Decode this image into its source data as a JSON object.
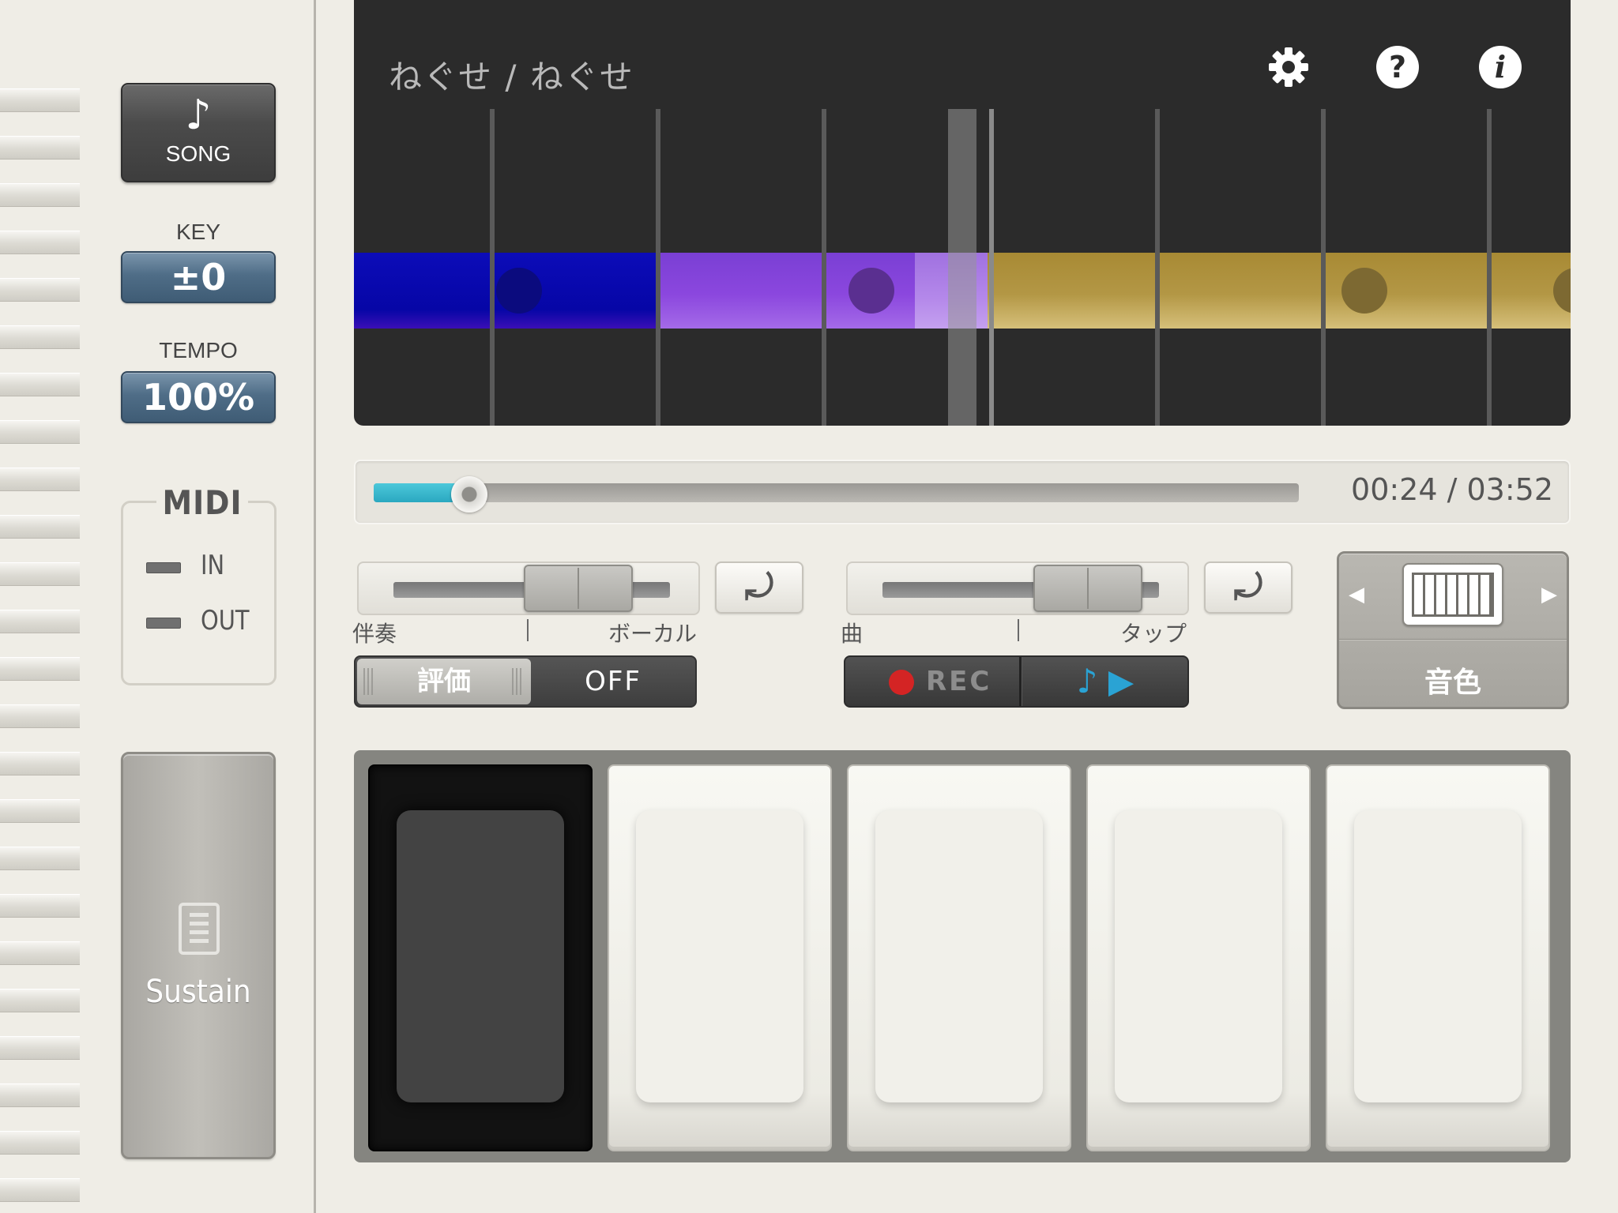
{
  "song_button": {
    "icon": "music-note-icon",
    "label": "SONG"
  },
  "key": {
    "label": "KEY",
    "value": "±0"
  },
  "tempo": {
    "label": "TEMPO",
    "value": "100%"
  },
  "midi": {
    "title": "MIDI",
    "in_label": "IN",
    "out_label": "OUT"
  },
  "sustain": {
    "icon": "sustain-pedal-icon",
    "label": "Sustain"
  },
  "screen": {
    "song_title": "ねぐせ / ねぐせ",
    "icons": [
      "settings-gear-icon",
      "help-icon",
      "info-icon"
    ],
    "help_glyph": "?",
    "info_glyph": "i",
    "lane_colors": [
      "#0a0ab0",
      "#8b47de",
      "#b39745"
    ]
  },
  "progress": {
    "time_text": "00:24 / 03:52",
    "fraction": 0.103,
    "accent": "#2aa8c0"
  },
  "balance_left": {
    "left_label": "伴奏",
    "right_label": "ボーカル",
    "value": 0.72,
    "reset_glyph": "⤾"
  },
  "balance_right": {
    "left_label": "曲",
    "right_label": "タップ",
    "value": 0.81,
    "reset_glyph": "⤾"
  },
  "score": {
    "label": "評価",
    "state": "OFF"
  },
  "rec": {
    "label": "REC",
    "rec_color": "#d42424",
    "play_glyph": "♪ ▶"
  },
  "voice": {
    "label": "音色",
    "icon": "keyboard-icon",
    "prev_glyph": "◀",
    "next_glyph": "▶"
  },
  "pads": [
    {
      "name": "pad-1",
      "active": true
    },
    {
      "name": "pad-2",
      "active": false
    },
    {
      "name": "pad-3",
      "active": false
    },
    {
      "name": "pad-4",
      "active": false
    },
    {
      "name": "pad-5",
      "active": false
    }
  ]
}
